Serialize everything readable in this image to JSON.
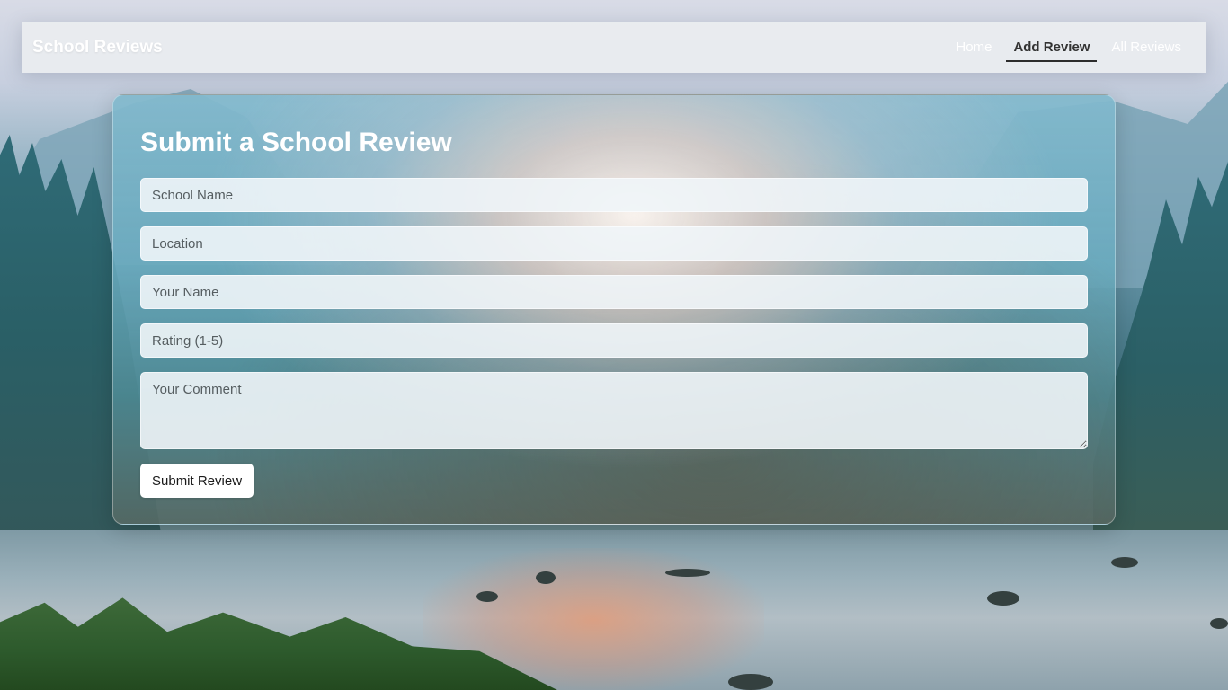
{
  "navbar": {
    "brand": "School Reviews",
    "links": [
      {
        "label": "Home",
        "active": false
      },
      {
        "label": "Add Review",
        "active": true
      },
      {
        "label": "All Reviews",
        "active": false
      }
    ]
  },
  "form": {
    "title": "Submit a School Review",
    "fields": {
      "school_name": {
        "placeholder": "School Name",
        "value": ""
      },
      "location": {
        "placeholder": "Location",
        "value": ""
      },
      "your_name": {
        "placeholder": "Your Name",
        "value": ""
      },
      "rating": {
        "placeholder": "Rating (1-5)",
        "value": ""
      },
      "comment": {
        "placeholder": "Your Comment",
        "value": ""
      }
    },
    "submit_label": "Submit Review"
  },
  "colors": {
    "brand_text": "#ffffff",
    "active_link": "#333333",
    "navbar_bg": "#eceef0",
    "button_bg": "#ffffff"
  }
}
